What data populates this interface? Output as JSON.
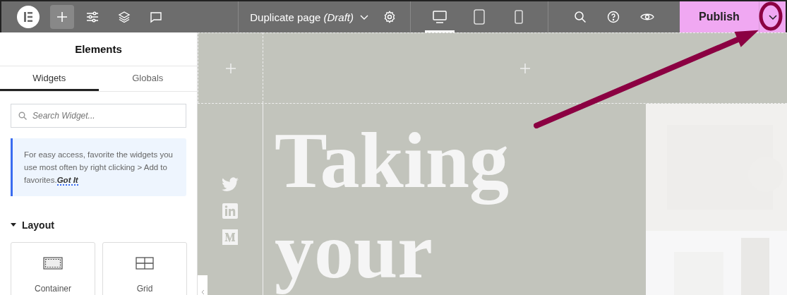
{
  "topbar": {
    "page_title": "Duplicate page *(Draft)*",
    "devices": [
      {
        "kind": "desktop",
        "selected": true
      },
      {
        "kind": "tablet",
        "selected": false
      },
      {
        "kind": "mobile",
        "selected": false
      }
    ],
    "publish": "Publish"
  },
  "panel": {
    "title": "Elements",
    "tabs": [
      {
        "label": "Widgets",
        "selected": true
      },
      {
        "label": "Globals",
        "selected": false
      }
    ],
    "search": {
      "placeholder": "Search Widget..."
    },
    "tip": {
      "text": "For easy access, favorite the widgets you use most often by right clicking > Add to favorites.",
      "link": "Got It"
    },
    "section": {
      "label": "Layout",
      "expanded": true
    },
    "widgets": [
      {
        "kind": "container",
        "label": "Container"
      },
      {
        "kind": "grid",
        "label": "Grid"
      }
    ]
  },
  "canvas": {
    "headline": [
      "Taking",
      "your"
    ]
  }
}
